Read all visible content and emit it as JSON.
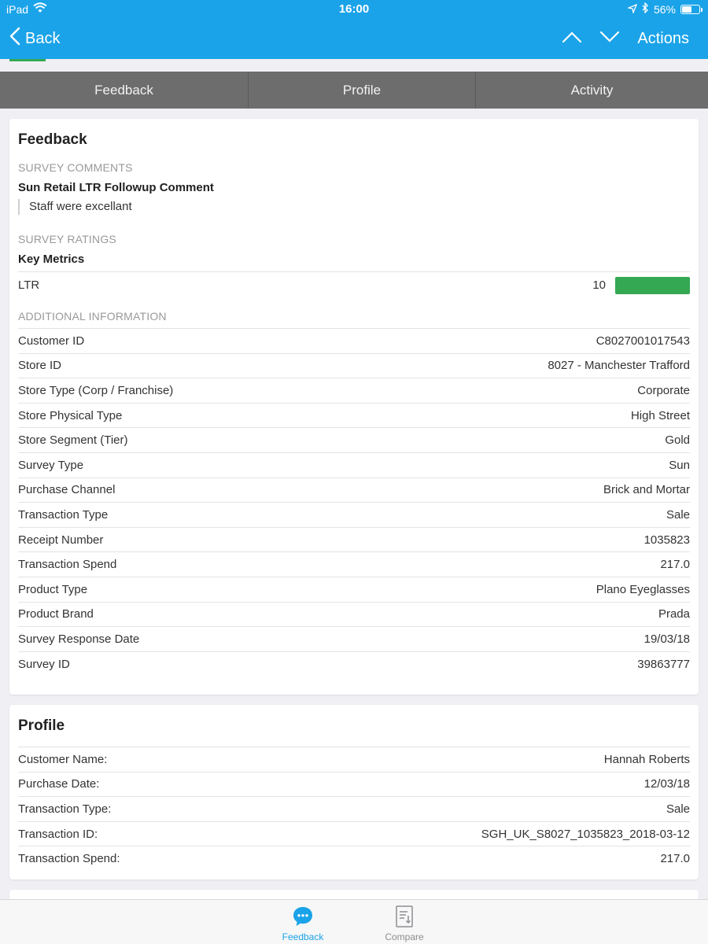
{
  "status": {
    "carrier": "iPad",
    "time": "16:00",
    "battery": "56%",
    "battery_level": 0.56
  },
  "nav": {
    "back_label": "Back",
    "actions_label": "Actions"
  },
  "tabs": [
    {
      "label": "Feedback"
    },
    {
      "label": "Profile"
    },
    {
      "label": "Activity"
    }
  ],
  "feedback": {
    "title": "Feedback",
    "survey_comments_label": "SURVEY COMMENTS",
    "comment_title": "Sun Retail LTR Followup Comment",
    "comment_text": "Staff were excellant",
    "survey_ratings_label": "SURVEY RATINGS",
    "key_metrics_label": "Key Metrics",
    "ltr": {
      "label": "LTR",
      "value": "10",
      "bar_color": "#34a853"
    },
    "additional_label": "ADDITIONAL INFORMATION",
    "rows": [
      {
        "k": "Customer ID",
        "v": "C8027001017543"
      },
      {
        "k": "Store ID",
        "v": "8027 - Manchester Trafford"
      },
      {
        "k": "Store Type (Corp / Franchise)",
        "v": "Corporate"
      },
      {
        "k": "Store Physical Type",
        "v": "High Street"
      },
      {
        "k": "Store Segment (Tier)",
        "v": "Gold"
      },
      {
        "k": "Survey Type",
        "v": "Sun"
      },
      {
        "k": "Purchase Channel",
        "v": "Brick and Mortar"
      },
      {
        "k": "Transaction Type",
        "v": "Sale"
      },
      {
        "k": "Receipt Number",
        "v": "1035823"
      },
      {
        "k": "Transaction Spend",
        "v": "217.0"
      },
      {
        "k": "Product Type",
        "v": "Plano Eyeglasses"
      },
      {
        "k": "Product Brand",
        "v": "Prada"
      },
      {
        "k": "Survey Response Date",
        "v": "19/03/18"
      },
      {
        "k": "Survey ID",
        "v": "39863777"
      }
    ]
  },
  "profile": {
    "title": "Profile",
    "rows": [
      {
        "k": "Customer Name:",
        "v": "Hannah Roberts"
      },
      {
        "k": "Purchase Date:",
        "v": "12/03/18"
      },
      {
        "k": "Transaction Type:",
        "v": "Sale"
      },
      {
        "k": "Transaction ID:",
        "v": "SGH_UK_S8027_1035823_2018-03-12"
      },
      {
        "k": "Transaction Spend:",
        "v": "217.0"
      }
    ]
  },
  "tabbar": {
    "feedback_label": "Feedback",
    "compare_label": "Compare",
    "active_color": "#1aa3e8",
    "inactive_color": "#8e8e93"
  },
  "colors": {
    "accent": "#1aa3e8",
    "tab_bg": "#6d6d6d",
    "good": "#34a853"
  }
}
